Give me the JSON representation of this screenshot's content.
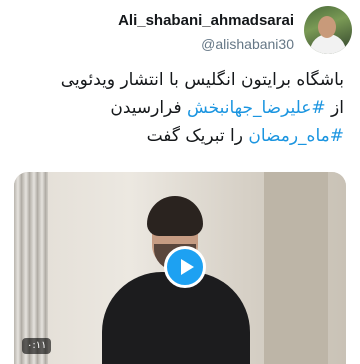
{
  "user": {
    "display_name": "Ali_shabani_ahmadsarai",
    "handle": "@alishabani30"
  },
  "tweet": {
    "line1": "باشگاه برایتون انگلیس با انتشار ویدئویی",
    "line2_prefix": "از ",
    "line2_hashtag": "#علیرضا_جهانبخش",
    "line2_suffix": " فرارسیدن",
    "line3_hashtag": "#ماه_رمضان",
    "line3_suffix": " را تبریک گفت"
  },
  "media": {
    "duration": "۰:۱۱",
    "play_icon": "play-icon"
  },
  "colors": {
    "accent": "#1da1f2",
    "hashtag": "#1b95e0",
    "secondary_text": "#657786"
  }
}
